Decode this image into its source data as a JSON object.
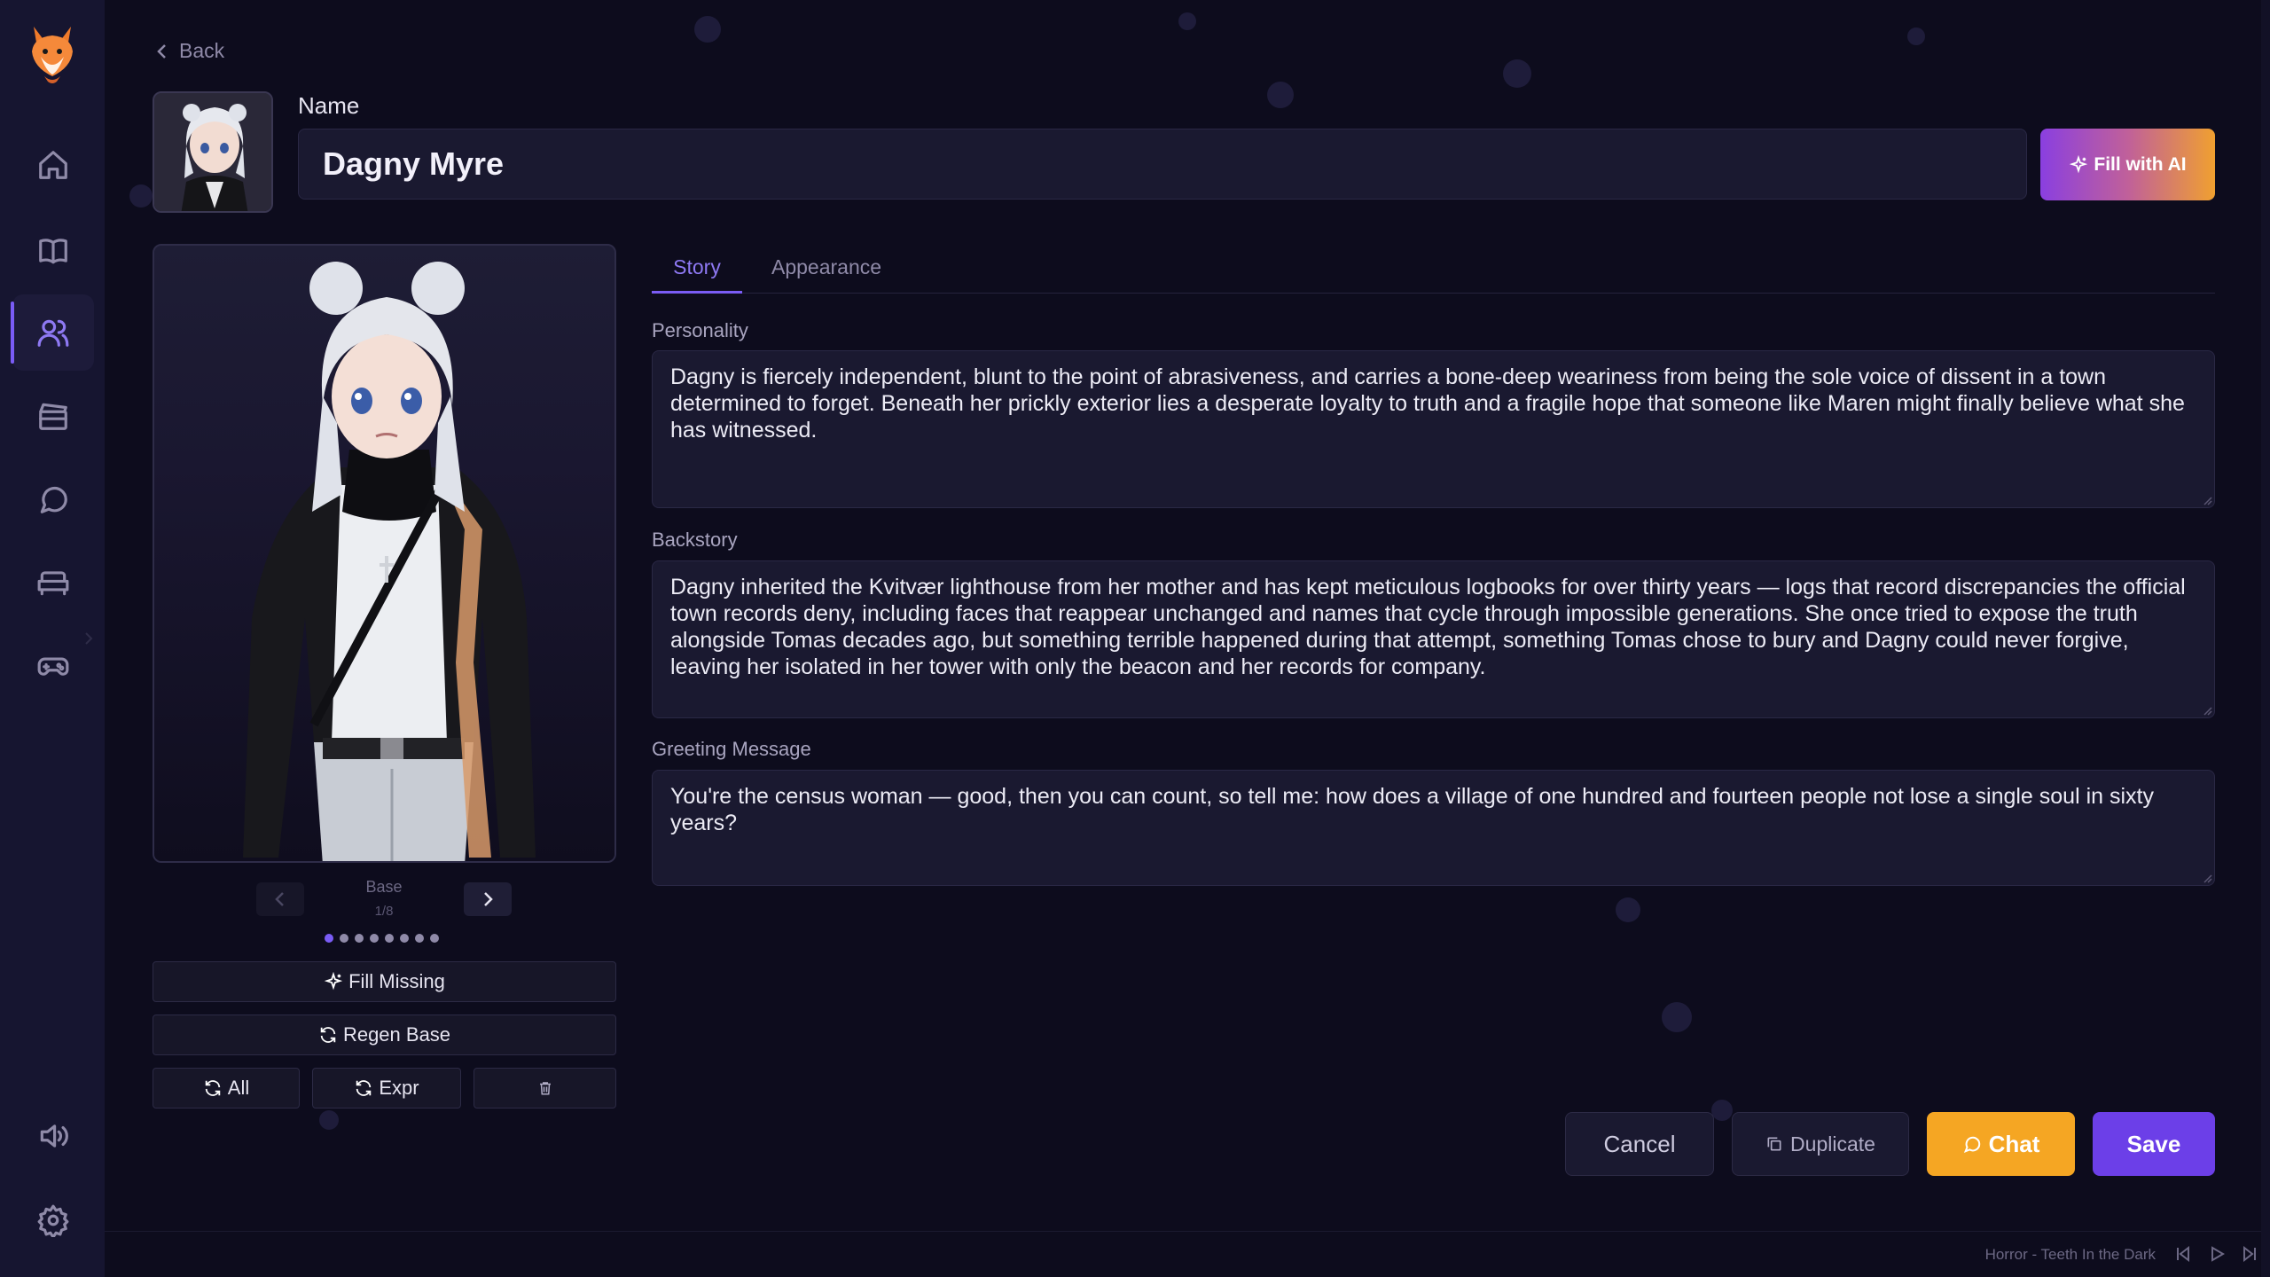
{
  "nav": {
    "back_label": "Back",
    "items": [
      {
        "name": "home",
        "icon": "home-icon"
      },
      {
        "name": "library",
        "icon": "book-icon"
      },
      {
        "name": "characters",
        "icon": "users-icon",
        "active": true
      },
      {
        "name": "scenes",
        "icon": "clapperboard-icon"
      },
      {
        "name": "chats",
        "icon": "chat-bubble-icon"
      },
      {
        "name": "rooms",
        "icon": "sofa-icon"
      },
      {
        "name": "games",
        "icon": "gamepad-icon"
      },
      {
        "name": "audio",
        "icon": "speaker-icon"
      },
      {
        "name": "settings",
        "icon": "gear-icon"
      }
    ]
  },
  "character": {
    "name_label": "Name",
    "name": "Dagny Myre",
    "fill_ai_label": "Fill with AI"
  },
  "portrait": {
    "variant_label": "Base",
    "variant_count": "1/8",
    "total_variants": 8,
    "current_index": 0
  },
  "image_actions": {
    "fill_missing": "Fill Missing",
    "regen_base": "Regen Base",
    "all": "All",
    "expr": "Expr"
  },
  "tabs": [
    {
      "label": "Story",
      "active": true
    },
    {
      "label": "Appearance",
      "active": false
    }
  ],
  "story": {
    "personality_label": "Personality",
    "personality": "Dagny is fiercely independent, blunt to the point of abrasiveness, and carries a bone-deep weariness from being the sole voice of dissent in a town determined to forget. Beneath her prickly exterior lies a desperate loyalty to truth and a fragile hope that someone like Maren might finally believe what she has witnessed.",
    "backstory_label": "Backstory",
    "backstory": "Dagny inherited the Kvitvær lighthouse from her mother and has kept meticulous logbooks for over thirty years — logs that record discrepancies the official town records deny, including faces that reappear unchanged and names that cycle through impossible generations. She once tried to expose the truth alongside Tomas decades ago, but something terrible happened during that attempt, something Tomas chose to bury and Dagny could never forgive, leaving her isolated in her tower with only the beacon and her records for company.",
    "greeting_label": "Greeting Message",
    "greeting": "You're the census woman — good, then you can count, so tell me: how does a village of one hundred and fourteen people not lose a single soul in sixty years?"
  },
  "actions": {
    "cancel": "Cancel",
    "duplicate": "Duplicate",
    "chat": "Chat",
    "save": "Save"
  },
  "player": {
    "now_playing": "Horror - Teeth In the Dark"
  },
  "colors": {
    "background": "#0d0c1d",
    "sidebar": "#161530",
    "accent_purple": "#7a5cf5",
    "chat_orange": "#f5a623",
    "save_purple": "#6c3fe8"
  }
}
